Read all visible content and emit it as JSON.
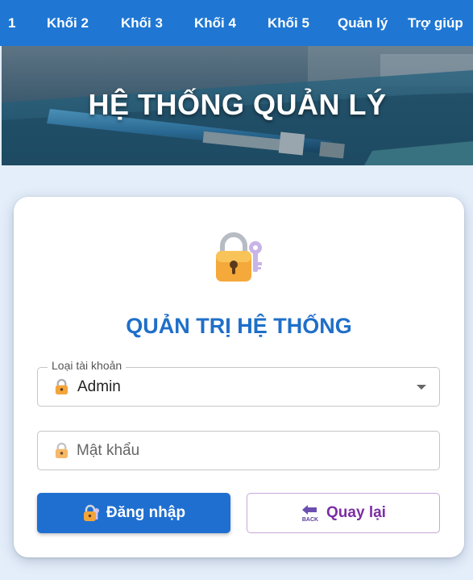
{
  "nav": {
    "items": [
      {
        "label": "1"
      },
      {
        "label": "Khối 2"
      },
      {
        "label": "Khối 3"
      },
      {
        "label": "Khối 4"
      },
      {
        "label": "Khối 5"
      },
      {
        "label": "Quản lý"
      },
      {
        "label": "Trợ giúp"
      }
    ]
  },
  "banner": {
    "title": "HỆ THỐNG QUẢN LÝ"
  },
  "card": {
    "title": "QUẢN TRỊ HỆ THỐNG",
    "account_type": {
      "legend": "Loại tài khoản",
      "value": "Admin"
    },
    "password": {
      "placeholder": "Mật khẩu",
      "value": ""
    },
    "login_label": "Đăng nhập",
    "back_label": "Quay lại",
    "back_icon_text": "BACK"
  },
  "colors": {
    "nav_bg": "#1f77d3",
    "title": "#1f6fc9",
    "primary_button": "#1f6fd1",
    "back_text": "#7b2fa3"
  },
  "icons": [
    "lock-key-icon",
    "lock-icon",
    "chevron-down-icon",
    "back-arrow-icon"
  ]
}
